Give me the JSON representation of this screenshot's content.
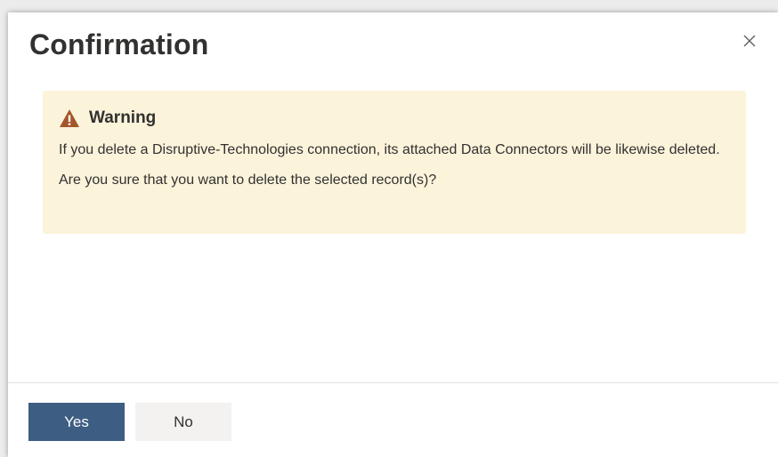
{
  "dialog": {
    "title": "Confirmation",
    "close_icon": "close-icon",
    "warning": {
      "icon": "warning-triangle-icon",
      "icon_color": "#a4562a",
      "background": "#fcf3db",
      "title": "Warning",
      "message": "If you delete a Disruptive-Technologies connection, its attached Data Connectors will be likewise deleted.",
      "question": "Are you sure that you want to delete the selected record(s)?"
    },
    "buttons": {
      "yes_label": "Yes",
      "yes_color": "#3d5d82",
      "no_label": "No"
    }
  }
}
